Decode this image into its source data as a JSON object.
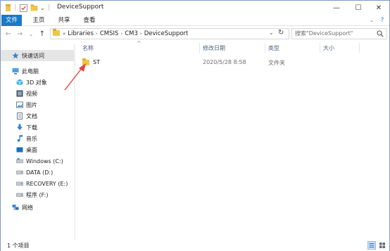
{
  "window": {
    "title": "DeviceSupport",
    "minimize": "—",
    "maximize": "☐",
    "close": "✕"
  },
  "ribbon": {
    "tabs": [
      "文件",
      "主页",
      "共享",
      "查看"
    ],
    "help": "?"
  },
  "nav": {
    "back": "←",
    "forward": "→",
    "recent": "⌄",
    "up": "↑",
    "breadcrumbs": [
      "Libraries",
      "CMSIS",
      "CM3",
      "DeviceSupport"
    ],
    "search_placeholder": "搜索\"DeviceSupport\"",
    "refresh": "↻"
  },
  "sidebar": {
    "items": [
      {
        "label": "快速访问",
        "icon": "star-icon",
        "selected": true
      },
      {
        "label": "此电脑",
        "icon": "computer-icon",
        "selected": false
      },
      {
        "label": "3D 对象",
        "icon": "cube-icon",
        "selected": false
      },
      {
        "label": "视频",
        "icon": "video-icon",
        "selected": false
      },
      {
        "label": "图片",
        "icon": "image-icon",
        "selected": false
      },
      {
        "label": "文档",
        "icon": "document-icon",
        "selected": false
      },
      {
        "label": "下载",
        "icon": "download-icon",
        "selected": false
      },
      {
        "label": "音乐",
        "icon": "music-icon",
        "selected": false
      },
      {
        "label": "桌面",
        "icon": "desktop-icon",
        "selected": false
      },
      {
        "label": "Windows (C:)",
        "icon": "drive-icon",
        "selected": false
      },
      {
        "label": "DATA (D:)",
        "icon": "drive-icon",
        "selected": false
      },
      {
        "label": "RECOVERY (E:)",
        "icon": "drive-icon",
        "selected": false
      },
      {
        "label": "程序 (F:)",
        "icon": "drive-icon",
        "selected": false
      },
      {
        "label": "网络",
        "icon": "network-icon",
        "selected": false
      }
    ]
  },
  "columns": {
    "name": "名称",
    "modified": "修改日期",
    "type": "类型",
    "size": "大小"
  },
  "files": [
    {
      "name": "ST",
      "modified": "2020/5/28 8:58",
      "type": "文件夹",
      "size": ""
    }
  ],
  "status": {
    "count": "1 个项目"
  },
  "colors": {
    "accent": "#1979ca",
    "annotation": "#e2453c",
    "folder": "#f0c54c"
  }
}
